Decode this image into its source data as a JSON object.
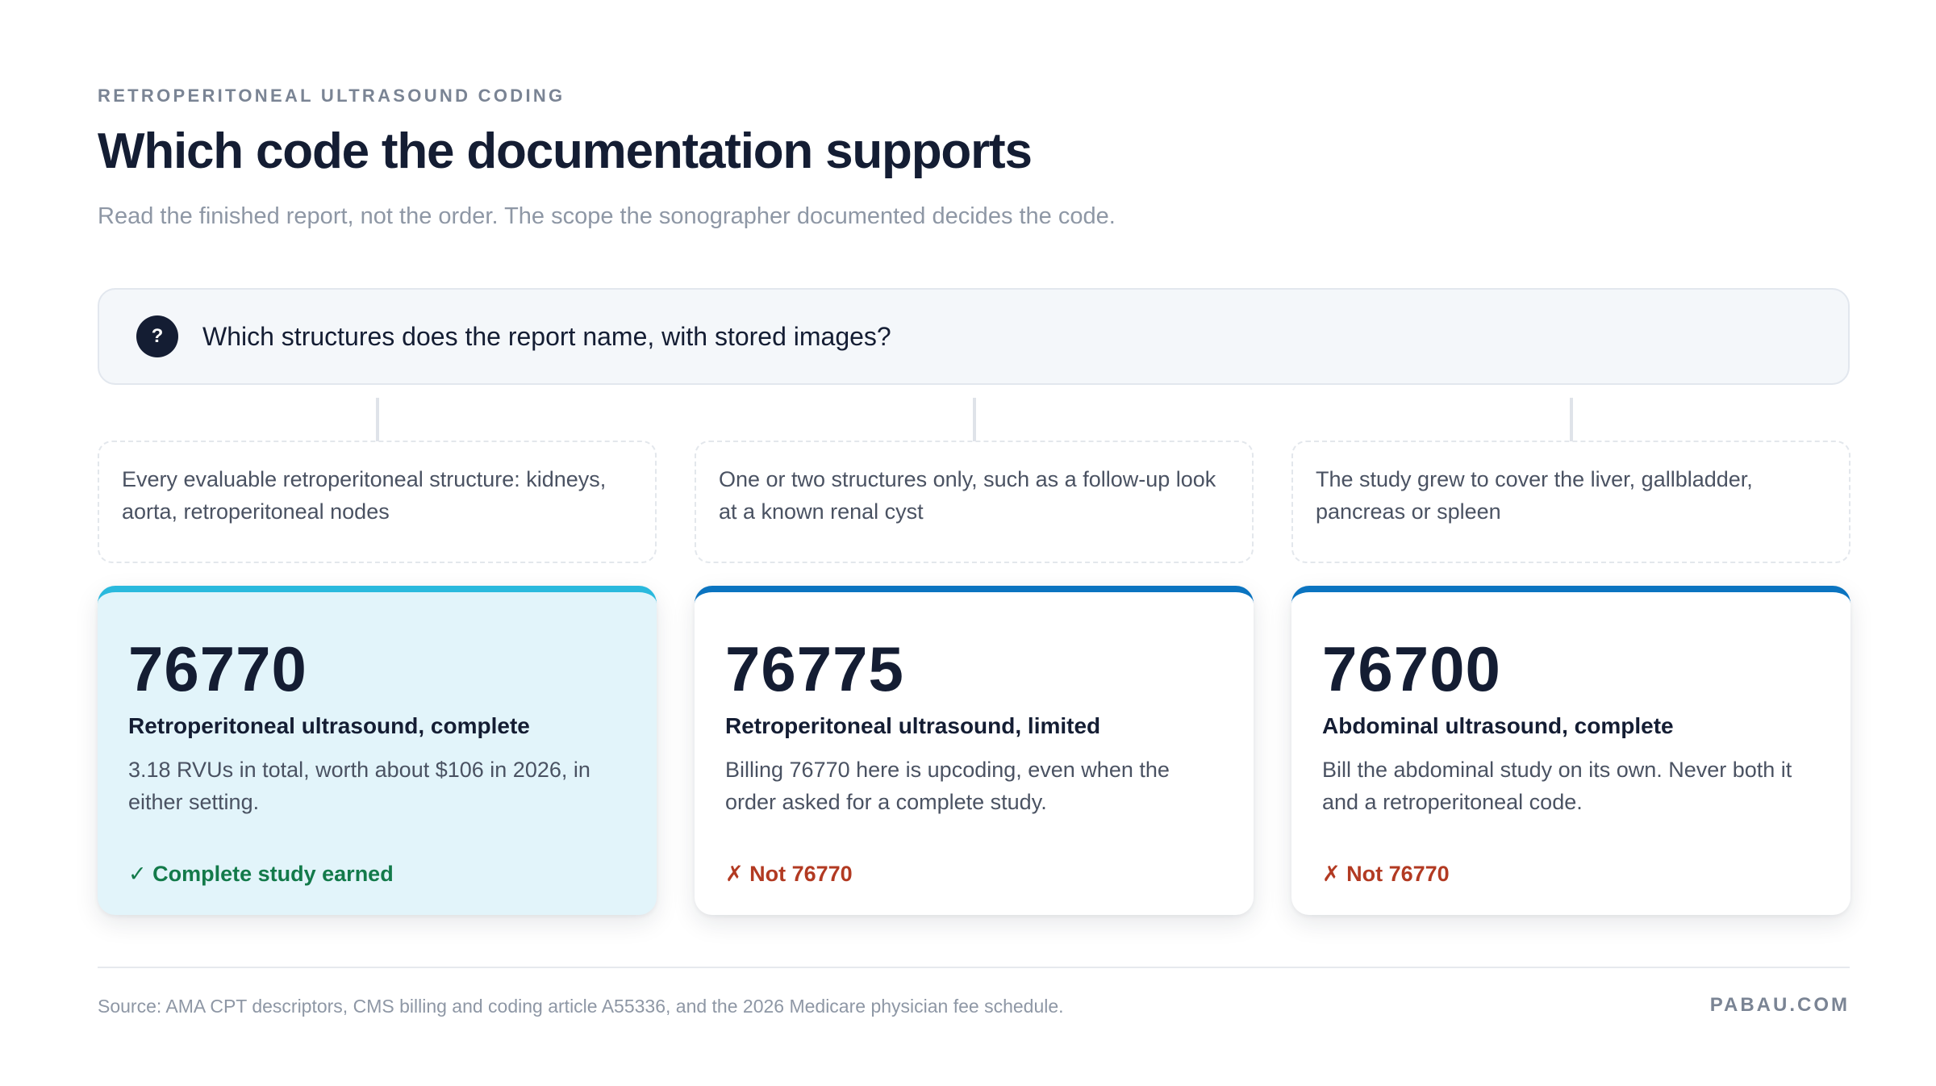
{
  "header": {
    "eyebrow": "RETROPERITONEAL ULTRASOUND CODING",
    "title": "Which code the documentation supports",
    "subtitle": "Read the finished report, not the order. The scope the sonographer documented decides the code."
  },
  "question": {
    "icon": "question-mark-icon",
    "icon_glyph": "?",
    "text": "Which structures does the report name, with stored images?"
  },
  "branches": [
    {
      "condition": "Every evaluable retroperitoneal structure: kidneys, aorta, retroperitoneal nodes",
      "code": "76770",
      "code_title": "Retroperitoneal ultrasound, complete",
      "body": "3.18 RVUs in total, worth about $106 in 2026, in either setting.",
      "verdict": "✓ Complete study earned",
      "accent": "#2ab9dd",
      "verdict_color": "#137a4a"
    },
    {
      "condition": "One or two structures only, such as a follow-up look at a known renal cyst",
      "code": "76775",
      "code_title": "Retroperitoneal ultrasound, limited",
      "body": "Billing 76770 here is upcoding, even when the order asked for a complete study.",
      "verdict": "✗ Not 76770",
      "accent": "#0b74c0",
      "verdict_color": "#b23a22"
    },
    {
      "condition": "The study grew to cover the liver, gallbladder, pancreas or spleen",
      "code": "76700",
      "code_title": "Abdominal ultrasound, complete",
      "body": "Bill the abdominal study on its own. Never both it and a retroperitoneal code.",
      "verdict": "✗ Not 76770",
      "accent": "#0b74c0",
      "verdict_color": "#b23a22"
    }
  ],
  "footer": {
    "source": "Source: AMA CPT descriptors, CMS billing and coding article A55336, and the 2026 Medicare physician fee schedule.",
    "brand": "PABAU.COM"
  }
}
